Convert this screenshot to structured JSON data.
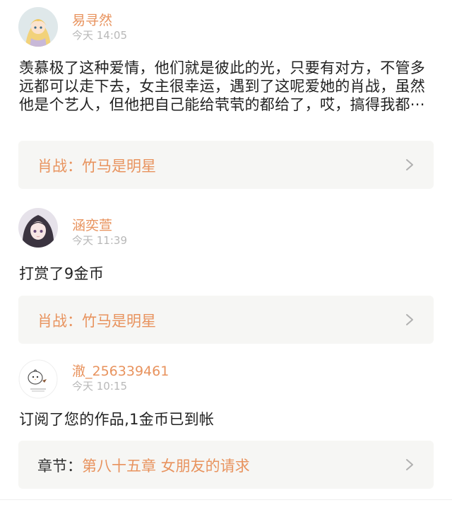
{
  "notifications": [
    {
      "username": "易寻然",
      "time": "今天 14:05",
      "content": "羡慕极了这种爱情，他们就是彼此的光，只要有对方，不管多远都可以走下去，女主很幸运，遇到了这呢爱她的肖战，虽然他是个艺人，但他把自己能给茕茕的都给了，哎，搞得我都···",
      "card_prefix": "肖战：",
      "card_title": "竹马是明星",
      "avatar_icon": "anime-girl-avatar-icon"
    },
    {
      "username": "涵奕萱",
      "time": "今天 11:39",
      "content": "打赏了9金币",
      "card_prefix": "肖战：",
      "card_title": "竹马是明星",
      "avatar_icon": "anime-girl-avatar-icon"
    },
    {
      "username": "澈_256339461",
      "time": "今天 10:15",
      "content": "订阅了您的作品,1金币已到帐",
      "card_prefix": "章节：",
      "card_title": "第八十五章 女朋友的请求",
      "avatar_icon": "chick-avatar-icon"
    }
  ],
  "colors": {
    "accent": "#e8935e",
    "time": "#b8b8b8",
    "card_bg": "#f6f6f4",
    "text": "#222222"
  }
}
